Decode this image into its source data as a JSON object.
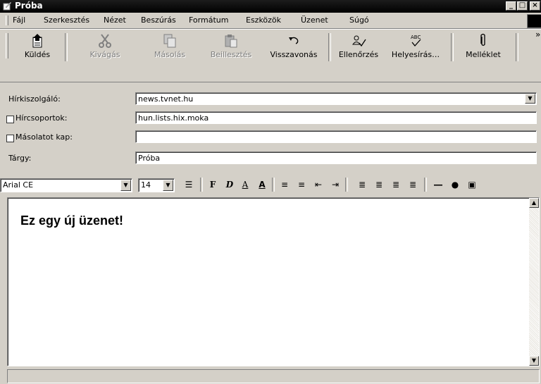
{
  "window": {
    "title": "Próba"
  },
  "menu": [
    {
      "label": "Fájl"
    },
    {
      "label": "Szerkesztés"
    },
    {
      "label": "Nézet"
    },
    {
      "label": "Beszúrás"
    },
    {
      "label": "Formátum"
    },
    {
      "label": "Eszközök"
    },
    {
      "label": "Üzenet"
    },
    {
      "label": "Súgó"
    }
  ],
  "toolbar": {
    "send": "Küldés",
    "cut": "Kivágás",
    "copy": "Másolás",
    "paste": "Beillesztés",
    "undo": "Visszavonás",
    "check": "Ellenőrzés",
    "spell": "Helyesírás…",
    "attach": "Melléklet",
    "more": "»"
  },
  "header": {
    "server_label": "Hírkiszolgáló:",
    "server_value": "news.tvnet.hu",
    "groups_label": "Hírcsoportok:",
    "groups_value": "hun.lists.hix.moka",
    "cc_label": "Másolatot kap:",
    "cc_value": "",
    "subject_label": "Tárgy:",
    "subject_value": "Próba"
  },
  "format": {
    "font": "Arial CE",
    "size": "14",
    "bold_glyph": "F",
    "italic_glyph": "D",
    "underline_glyph": "A",
    "color_glyph": "A"
  },
  "body": {
    "text": "Ez egy új üzenet!"
  }
}
